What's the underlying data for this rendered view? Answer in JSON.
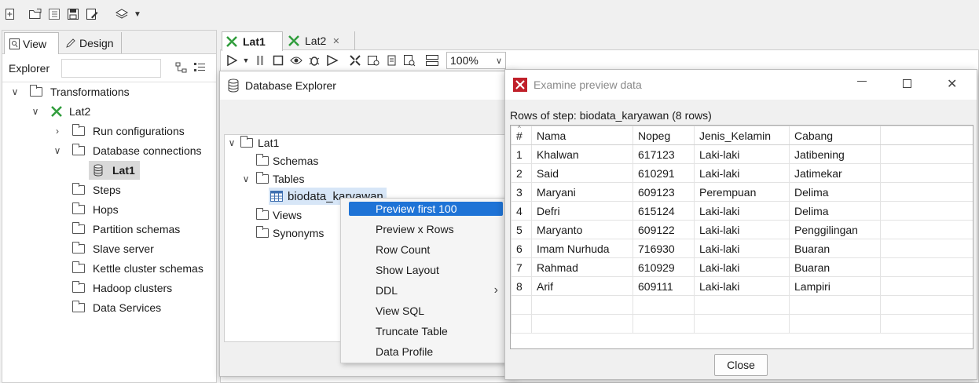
{
  "toolbar": {
    "icons": [
      "new-file-icon",
      "open-icon",
      "explorer-icon",
      "save-icon",
      "save-as-icon",
      "layers-icon"
    ]
  },
  "left_panel": {
    "tabs": [
      {
        "label": "View"
      },
      {
        "label": "Design"
      }
    ],
    "explorer_label": "Explorer",
    "search_placeholder": "",
    "tree": {
      "transformations": "Transformations",
      "lat2": "Lat2",
      "run_configurations": "Run configurations",
      "database_connections": "Database connections",
      "lat1": "Lat1",
      "steps": "Steps",
      "hops": "Hops",
      "partition_schemas": "Partition schemas",
      "slave_server": "Slave server",
      "kettle_cluster_schemas": "Kettle cluster schemas",
      "hadoop_clusters": "Hadoop clusters",
      "data_services": "Data Services"
    }
  },
  "editor": {
    "tabs": [
      {
        "label": "Lat1"
      },
      {
        "label": "Lat2"
      }
    ],
    "zoom": "100%"
  },
  "db_explorer": {
    "title": "Database Explorer",
    "tree": {
      "root": "Lat1",
      "schemas": "Schemas",
      "tables": "Tables",
      "table": "biodata_karyawan",
      "views": "Views",
      "synonyms": "Synonyms"
    }
  },
  "context_menu": {
    "items": [
      {
        "label": "Preview first 100"
      },
      {
        "label": "Preview x Rows"
      },
      {
        "label": "Row Count"
      },
      {
        "label": "Show Layout"
      },
      {
        "label": "DDL"
      },
      {
        "label": "View SQL"
      },
      {
        "label": "Truncate Table"
      },
      {
        "label": "Data Profile"
      }
    ]
  },
  "preview_dialog": {
    "title": "Examine preview data",
    "caption": "Rows of step: biodata_karyawan (8 rows)",
    "columns": [
      "#",
      "Nama",
      "Nopeg",
      "Jenis_Kelamin",
      "Cabang"
    ],
    "rows": [
      [
        "1",
        "Khalwan",
        "617123",
        "Laki-laki",
        "Jatibening"
      ],
      [
        "2",
        "Said",
        "610291",
        "Laki-laki",
        "Jatimekar"
      ],
      [
        "3",
        "Maryani",
        "609123",
        "Perempuan",
        "Delima"
      ],
      [
        "4",
        "Defri",
        "615124",
        "Laki-laki",
        "Delima"
      ],
      [
        "5",
        "Maryanto",
        "609122",
        "Laki-laki",
        "Penggilingan"
      ],
      [
        "6",
        "Imam Nurhuda",
        "716930",
        "Laki-laki",
        "Buaran"
      ],
      [
        "7",
        "Rahmad",
        "610929",
        "Laki-laki",
        "Buaran"
      ],
      [
        "8",
        "Arif",
        "609111",
        "Laki-laki",
        "Lampiri"
      ]
    ],
    "close_label": "Close"
  },
  "colors": {
    "accent": "#1e73d6",
    "transform_icon": "#2e9c3a",
    "dialog_icon": "#c0202a"
  }
}
